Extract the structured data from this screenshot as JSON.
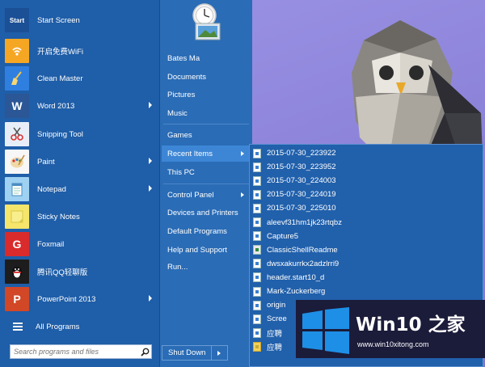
{
  "programs": [
    {
      "label": "Start Screen",
      "tile_text": "Start",
      "tile_color": "#1b4f96",
      "icon": "start-screen-icon"
    },
    {
      "label": "开启免费WiFi",
      "tile_text": "",
      "tile_color": "#f5a623",
      "icon": "wifi-icon"
    },
    {
      "label": "Clean Master",
      "tile_text": "",
      "tile_color": "#2f7fe0",
      "icon": "broom-icon"
    },
    {
      "label": "Word 2013",
      "tile_text": "W",
      "tile_color": "#2b5797",
      "icon": "word-icon",
      "has_submenu": true
    },
    {
      "label": "Snipping Tool",
      "tile_text": "",
      "tile_color": "#e8eef8",
      "icon": "scissors-icon"
    },
    {
      "label": "Paint",
      "tile_text": "",
      "tile_color": "#f7f7f7",
      "icon": "paint-palette-icon",
      "has_submenu": true
    },
    {
      "label": "Notepad",
      "tile_text": "",
      "tile_color": "#9fd1f2",
      "icon": "notepad-icon",
      "has_submenu": true
    },
    {
      "label": "Sticky Notes",
      "tile_text": "",
      "tile_color": "#f5e66b",
      "icon": "sticky-note-icon"
    },
    {
      "label": "Foxmail",
      "tile_text": "G",
      "tile_color": "#d92b2b",
      "icon": "foxmail-icon"
    },
    {
      "label": "腾讯QQ轻聊版",
      "tile_text": "",
      "tile_color": "#1d1d1d",
      "icon": "qq-penguin-icon"
    },
    {
      "label": "PowerPoint 2013",
      "tile_text": "P",
      "tile_color": "#d24726",
      "icon": "powerpoint-icon",
      "has_submenu": true
    }
  ],
  "all_programs": "All Programs",
  "search": {
    "placeholder": "Search programs and files"
  },
  "right_links": [
    {
      "label": "Bates Ma"
    },
    {
      "label": "Documents"
    },
    {
      "label": "Pictures"
    },
    {
      "label": "Music"
    },
    {
      "label": "Games"
    },
    {
      "label": "Recent Items",
      "has_submenu": true,
      "selected": true
    },
    {
      "label": "This PC"
    },
    {
      "label": "Control Panel",
      "has_submenu": true
    },
    {
      "label": "Devices and Printers"
    },
    {
      "label": "Default Programs"
    },
    {
      "label": "Help and Support"
    },
    {
      "label": "Run..."
    }
  ],
  "shutdown": {
    "label": "Shut Down"
  },
  "recent_items": [
    {
      "label": "2015-07-30_223922",
      "icon": "image-file-icon"
    },
    {
      "label": "2015-07-30_223952",
      "icon": "image-file-icon"
    },
    {
      "label": "2015-07-30_224003",
      "icon": "image-file-icon"
    },
    {
      "label": "2015-07-30_224019",
      "icon": "image-file-icon"
    },
    {
      "label": "2015-07-30_225010",
      "icon": "image-file-icon"
    },
    {
      "label": "aleevf31hm1jk23rtqbz",
      "icon": "image-file-icon"
    },
    {
      "label": "Capture5",
      "icon": "image-file-icon"
    },
    {
      "label": "ClassicShellReadme",
      "icon": "readme-file-icon"
    },
    {
      "label": "dwsxakurrkx2adzlrri9",
      "icon": "image-file-icon"
    },
    {
      "label": "header.start10_d",
      "icon": "image-file-icon"
    },
    {
      "label": "Mark-Zuckerberg",
      "icon": "image-file-icon"
    },
    {
      "label": "origin",
      "icon": "image-file-icon"
    },
    {
      "label": "Scree",
      "icon": "image-file-icon"
    },
    {
      "label": "应聘",
      "icon": "image-file-icon"
    },
    {
      "label": "应聘",
      "icon": "zip-file-icon"
    }
  ],
  "watermark": {
    "title": "Win10 之家",
    "url": "www.win10xitong.com"
  },
  "colors": {
    "menu_left": "#1f5ea8",
    "menu_right": "#2a6cb6",
    "highlight": "#3d86d6",
    "submenu": "#2160ab"
  }
}
